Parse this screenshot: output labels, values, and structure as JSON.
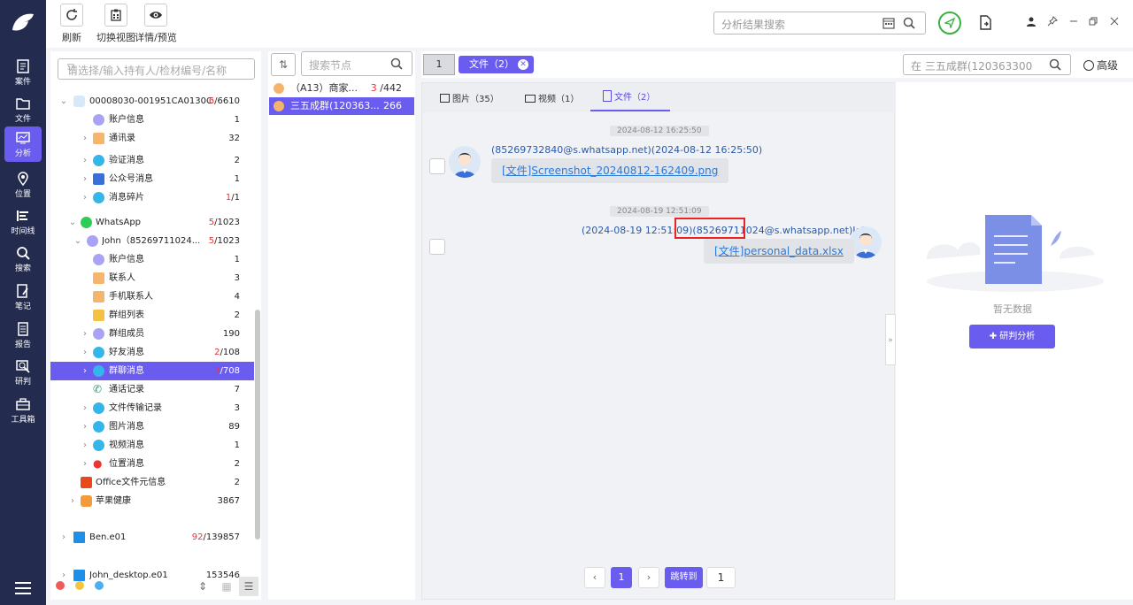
{
  "leftnav": {
    "items": [
      {
        "label": "案件",
        "icon": "case-icon"
      },
      {
        "label": "文件",
        "icon": "folder-icon"
      },
      {
        "label": "分析",
        "icon": "analysis-icon"
      },
      {
        "label": "位置",
        "icon": "location-icon"
      },
      {
        "label": "时间线",
        "icon": "timeline-icon"
      },
      {
        "label": "搜索",
        "icon": "search-icon"
      },
      {
        "label": "笔记",
        "icon": "notes-icon"
      },
      {
        "label": "报告",
        "icon": "report-icon"
      },
      {
        "label": "研判",
        "icon": "judge-icon"
      },
      {
        "label": "工具箱",
        "icon": "toolbox-icon"
      }
    ]
  },
  "toolbar": {
    "refresh_label": "刷新",
    "switch_view_label": "切换视图",
    "details_label": "详情/预览",
    "search_placeholder": "分析结果搜索"
  },
  "tree": {
    "search_placeholder": "请选择/输入持有人/检材编号/名称",
    "rows": [
      {
        "label": "00008030-001951CA0130C0...",
        "count_red": "6",
        "count": "/6610"
      },
      {
        "label": "账户信息",
        "count_red": "",
        "count": "1"
      },
      {
        "label": "通讯录",
        "count_red": "",
        "count": "32"
      },
      {
        "label": "验证消息",
        "count_red": "",
        "count": "2"
      },
      {
        "label": "公众号消息",
        "count_red": "",
        "count": "1"
      },
      {
        "label": "消息碎片",
        "count_red": "1",
        "count": "/1"
      },
      {
        "label": "WhatsApp",
        "count_red": "5",
        "count": "/1023"
      },
      {
        "label": "John（85269711024...",
        "count_red": "5",
        "count": "/1023"
      },
      {
        "label": "账户信息",
        "count_red": "",
        "count": "1"
      },
      {
        "label": "联系人",
        "count_red": "",
        "count": "3"
      },
      {
        "label": "手机联系人",
        "count_red": "",
        "count": "4"
      },
      {
        "label": "群组列表",
        "count_red": "",
        "count": "2"
      },
      {
        "label": "群组成员",
        "count_red": "",
        "count": "190"
      },
      {
        "label": "好友消息",
        "count_red": "2",
        "count": "/108"
      },
      {
        "label": "群聊消息",
        "count_red": "3",
        "count": "/708"
      },
      {
        "label": "通话记录",
        "count_red": "",
        "count": "7"
      },
      {
        "label": "文件传输记录",
        "count_red": "",
        "count": "3"
      },
      {
        "label": "图片消息",
        "count_red": "",
        "count": "89"
      },
      {
        "label": "视频消息",
        "count_red": "",
        "count": "1"
      },
      {
        "label": "位置消息",
        "count_red": "",
        "count": "2"
      },
      {
        "label": "Office文件元信息",
        "count_red": "",
        "count": "2"
      },
      {
        "label": "苹果健康",
        "count_red": "",
        "count": "3867"
      },
      {
        "label": "Ben.e01",
        "count_red": "92",
        "count": "/139857"
      },
      {
        "label": "John_desktop.e01",
        "count_red": "",
        "count": "153546"
      }
    ]
  },
  "nodes": {
    "search_placeholder": "搜索节点",
    "rows": [
      {
        "label": "（A13）商家...",
        "count_red": "3",
        "count": "/442"
      },
      {
        "label": "三五成群(120363...",
        "count_red": "",
        "count": "266"
      }
    ]
  },
  "main": {
    "page_indicator": "1",
    "file_tag": "文件（2）",
    "inner_search_placeholder": "在 三五成群(120363300",
    "advanced_label": "高级",
    "tabs": [
      {
        "label": "图片（35）"
      },
      {
        "label": "视频（1）"
      },
      {
        "label": "文件（2）"
      }
    ],
    "messages": [
      {
        "timestamp": "2024-08-12 16:25:50",
        "sender": "(85269732840@s.whatsapp.net)(2024-08-12 16:25:50)",
        "content": "[文件]Screenshot_20240812-162409.png"
      },
      {
        "timestamp": "2024-08-19 12:51:09",
        "sender_prefix": "(2024-08-19 12:51:09)",
        "sender_highlight": "(85269711024",
        "sender_suffix": "@s.whatsapp.net)John",
        "content": "[文件]personal_data.xlsx"
      }
    ],
    "pager": {
      "current": "1",
      "jump_label": "跳转到",
      "jump_value": "1"
    }
  },
  "right": {
    "empty_text": "暂无数据",
    "judge_button": "✚ 研判分析"
  },
  "colors": {
    "accent": "#6b5cf0",
    "nav_bg": "#232c4e",
    "link": "#2a7ad8",
    "highlight": "#e22222"
  }
}
